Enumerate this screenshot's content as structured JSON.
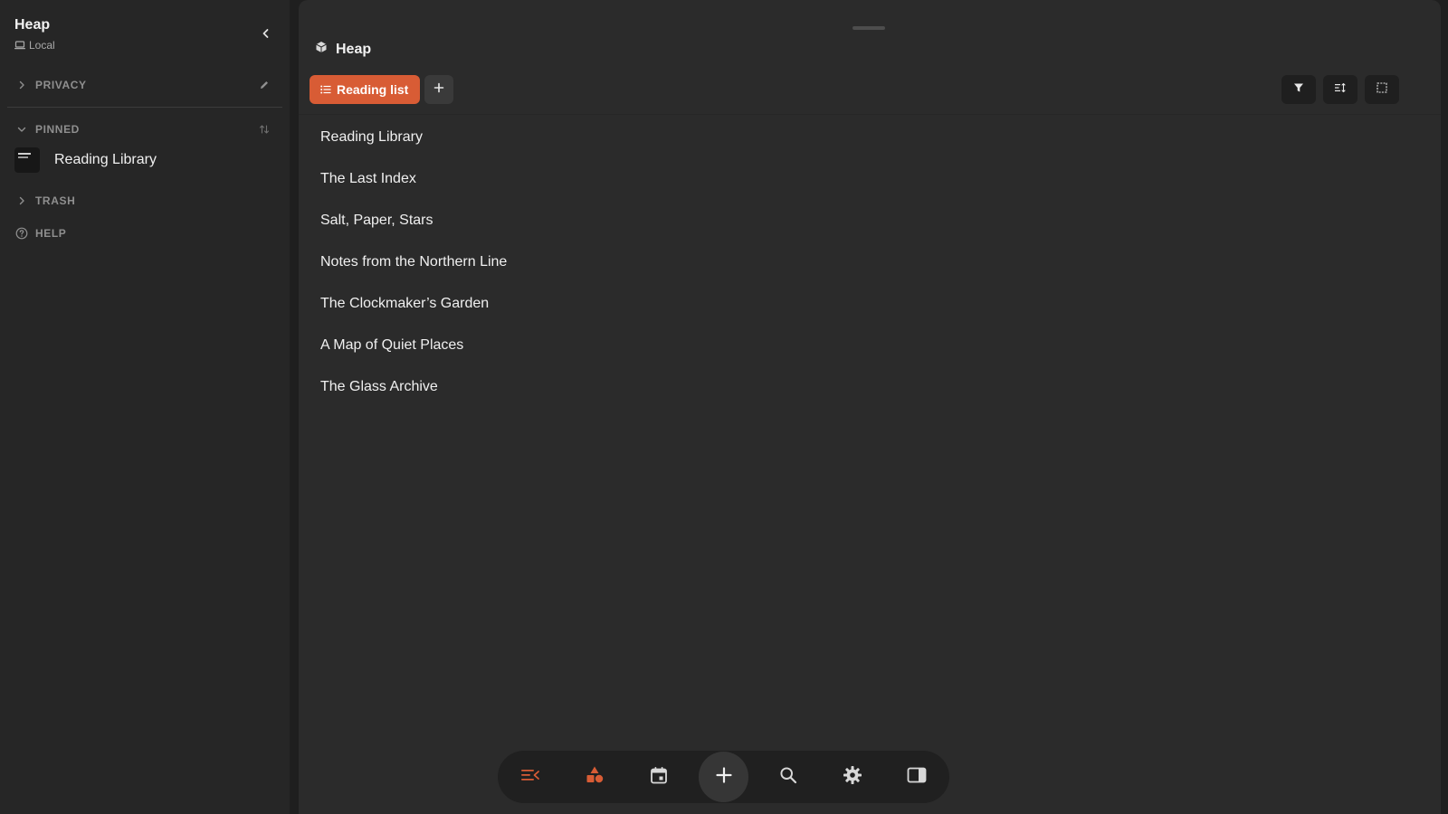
{
  "sidebar": {
    "workspace_name": "Heap",
    "workspace_location": "Local",
    "sections": {
      "privacy": "PRIVACY",
      "pinned": "PINNED",
      "trash": "TRASH",
      "help": "HELP"
    },
    "pinned_items": [
      {
        "label": "Reading Library"
      }
    ]
  },
  "main": {
    "space_title": "Heap",
    "view_tab_label": "Reading list",
    "items": [
      "Reading Library",
      "The Last Index",
      "Salt, Paper, Stars",
      "Notes from the Northern Line",
      "The Clockmaker’s Garden",
      "A Map of Quiet Places",
      "The Glass Archive"
    ]
  },
  "toolbar_icons": [
    "filter-icon",
    "sort-icon",
    "view-options-icon"
  ],
  "dock_icons": [
    "timeline-icon",
    "shapes-icon",
    "calendar-icon",
    "plus-icon",
    "search-icon",
    "gear-icon",
    "panel-icon"
  ],
  "colors": {
    "accent": "#d85c35",
    "sidebar_bg": "#262626",
    "main_bg": "#2b2b2b",
    "dock_bg": "#202020"
  }
}
